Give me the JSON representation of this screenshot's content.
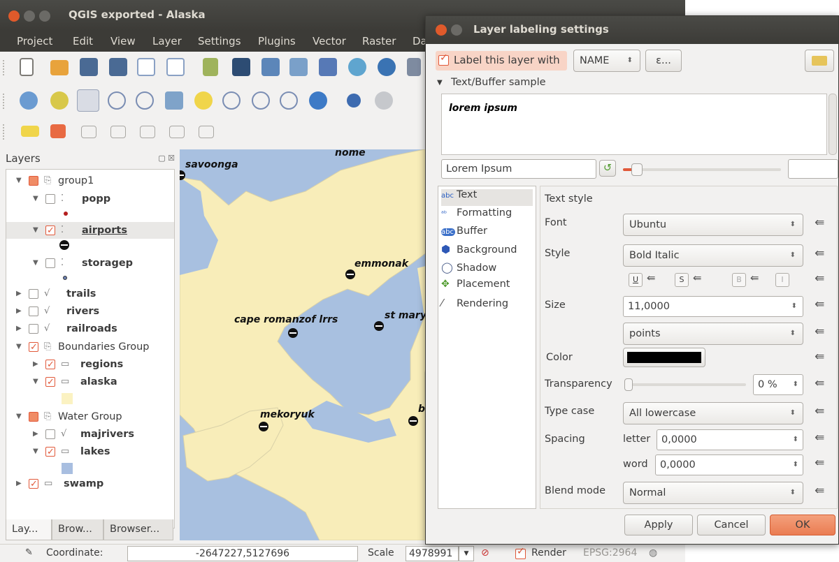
{
  "qgis": {
    "title": "QGIS exported - Alaska",
    "menu": [
      "Project",
      "Edit",
      "View",
      "Layer",
      "Settings",
      "Plugins",
      "Vector",
      "Raster",
      "Da"
    ]
  },
  "layers_panel": {
    "title": "Layers",
    "items": [
      {
        "label": "group1"
      },
      {
        "label": "popp"
      },
      {
        "label": "airports"
      },
      {
        "label": "storagep"
      },
      {
        "label": "trails"
      },
      {
        "label": "rivers"
      },
      {
        "label": "railroads"
      },
      {
        "label": "Boundaries Group"
      },
      {
        "label": "regions"
      },
      {
        "label": "alaska"
      },
      {
        "label": "Water Group"
      },
      {
        "label": "majrivers"
      },
      {
        "label": "lakes"
      },
      {
        "label": "swamp"
      }
    ],
    "tabs": [
      "Lay...",
      "Brow...",
      "Browser..."
    ]
  },
  "map": {
    "places": [
      "nome",
      "savoonga",
      "emmonak",
      "st mary",
      "cape romanzof lrrs",
      "mekoryuk",
      "b"
    ]
  },
  "status": {
    "coordinate_label": "Coordinate:",
    "coordinate_value": "-2647227,5127696",
    "scale_label": "Scale",
    "scale_value": "4978991",
    "render_label": "Render",
    "crs": "EPSG:2964"
  },
  "dialog": {
    "title": "Layer labeling settings",
    "label_with": "Label this layer with",
    "field_value": "NAME",
    "expr_button": "ε...",
    "sample_header": "Text/Buffer sample",
    "sample_text": "lorem ipsum",
    "sample_input": "Lorem Ipsum",
    "categories": [
      "Text",
      "Formatting",
      "Buffer",
      "Background",
      "Shadow",
      "Placement",
      "Rendering"
    ],
    "section_title": "Text style",
    "font_label": "Font",
    "font_value": "Ubuntu",
    "style_label": "Style",
    "style_value": "Bold Italic",
    "format_buttons": [
      "U",
      "S",
      "B",
      "I"
    ],
    "size_label": "Size",
    "size_value": "11,0000",
    "unit_value": "points",
    "color_label": "Color",
    "color_value": "#000000",
    "transparency_label": "Transparency",
    "transparency_value": "0 %",
    "typecase_label": "Type case",
    "typecase_value": "All lowercase",
    "spacing_label": "Spacing",
    "letter_label": "letter",
    "letter_value": "0,0000",
    "word_label": "word",
    "word_value": "0,0000",
    "blend_label": "Blend mode",
    "blend_value": "Normal",
    "apply": "Apply",
    "cancel": "Cancel",
    "ok": "OK"
  }
}
